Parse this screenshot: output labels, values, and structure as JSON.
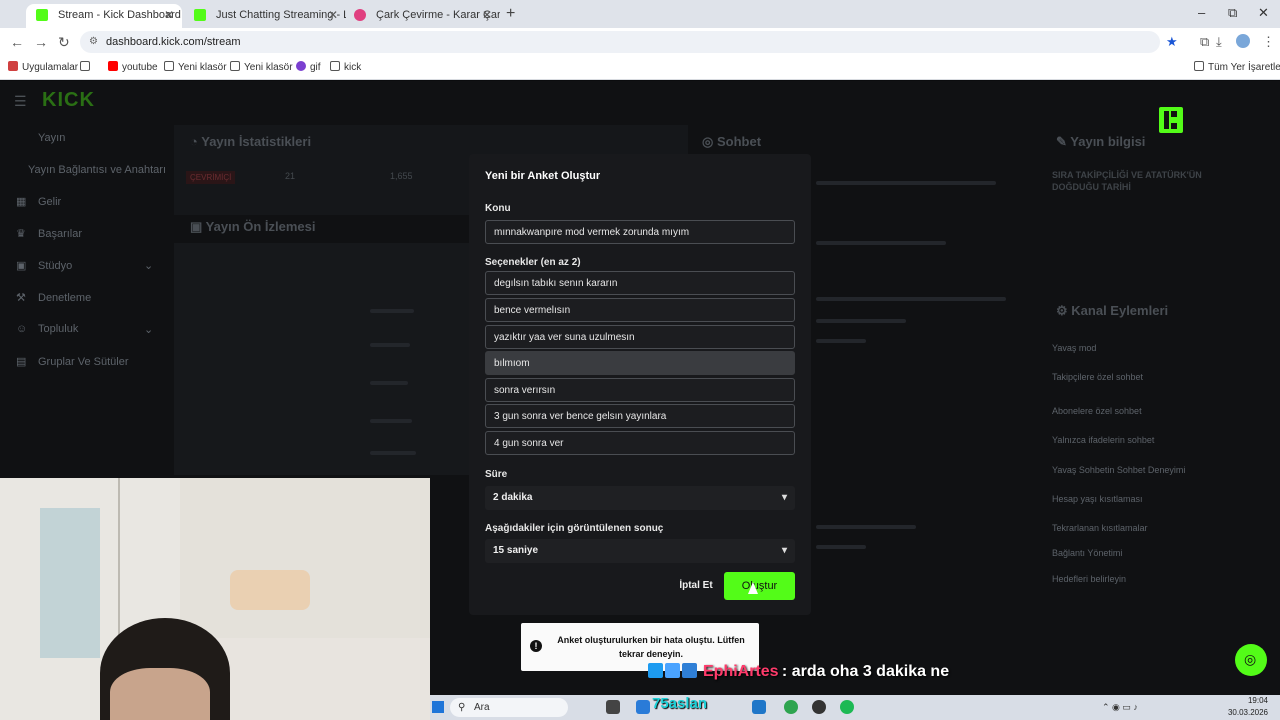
{
  "browser": {
    "tabs": [
      {
        "label": "Stream - Kick Dashboard",
        "active": true,
        "color": "#53fc18"
      },
      {
        "label": "Just Chatting Streaming - Live S",
        "active": false,
        "color": "#53fc18"
      },
      {
        "label": "Çark Çevirme - Karar Çarkı",
        "active": false,
        "color": "#e04080"
      }
    ],
    "new_tab": "+",
    "window_controls": {
      "minimize": "–",
      "restore": "⧉",
      "close": "✕"
    },
    "url": "dashboard.kick.com/stream",
    "bookmarks": [
      {
        "label": "Uygulamalar",
        "icon": "grid-icon"
      },
      {
        "label": "youtube",
        "icon": "youtube-icon"
      },
      {
        "label": "Yeni klasör",
        "icon": "folder-icon"
      },
      {
        "label": "Yeni klasör",
        "icon": "folder-icon"
      },
      {
        "label": "gif",
        "icon": "gif-icon"
      },
      {
        "label": "kick",
        "icon": "kick-icon"
      }
    ],
    "all_bookmarks": "Tüm Yer İşaretleri"
  },
  "dashboard": {
    "logo": "KICK",
    "sidebar": [
      {
        "label": "Yayın",
        "icon": "home-icon"
      },
      {
        "label": "Yayın Bağlantısı ve Anahtarı",
        "icon": ""
      },
      {
        "label": "Gelir",
        "icon": "money-icon"
      },
      {
        "label": "Başarılar",
        "icon": "trophy-icon"
      },
      {
        "label": "Stüdyo",
        "icon": "studio-icon"
      },
      {
        "label": "Denetleme",
        "icon": "shield-icon"
      },
      {
        "label": "Topluluk",
        "icon": "users-icon"
      },
      {
        "label": "Gruplar Ve Sütüler",
        "icon": "clip-icon"
      }
    ],
    "panels": {
      "stats": "Yayın İstatistikleri",
      "preview": "Yayın Ön İzlemesi",
      "chat": "Sohbet",
      "info": "Yayın bilgisi",
      "channel_actions": "Kanal Eylemleri"
    },
    "stats_values": {
      "status": "ÇEVRİMİÇİ",
      "viewers": "21",
      "followers": "1,655"
    },
    "info_title": "SIRA TAKİPÇİLİĞİ VE ATATÜRK'ÜN DOĞDUĞU TARİHİ",
    "channel_actions_items": [
      "Yavaş mod",
      "Takipçilere özel sohbet",
      "Abonelere özel sohbet",
      "Yalnızca ifadelerin sohbet",
      "Yavaş Sohbetin Sohbet Deneyimi",
      "Hesap yaşı kısıtlaması",
      "Tekrarlanan kısıtlamalar",
      "Bağlantı Yönetimi",
      "Hedefleri belirleyin"
    ]
  },
  "modal": {
    "title": "Yeni bir Anket Oluştur",
    "topic_label": "Konu",
    "topic_value": "mınnakwanpıre mod vermek zorunda mıyım",
    "options_label": "Seçenekler (en az 2)",
    "options": [
      "degılsın tabıkı senın kararın",
      "bence vermelısın",
      "yazıktır yaa ver suna uzulmesın",
      "bılmıom",
      "sonra verırsın",
      "3 gun sonra ver bence gelsın yayınlara",
      "4 gun sonra ver"
    ],
    "duration_label": "Süre",
    "duration_value": "2 dakika",
    "result_label": "Aşağıdakiler için görüntülenen sonuç",
    "result_value": "15 saniye",
    "cancel": "İptal Et",
    "create": "Oluştur"
  },
  "toast": {
    "message": "Anket oluşturulurken bir hata oluştu. Lütfen tekrar deneyin."
  },
  "stream_overlay": {
    "chat_user": "EphiArtes",
    "chat_message": ": arda oha 3 dakika ne",
    "streamer_name": "75aslan"
  },
  "taskbar": {
    "search_placeholder": "Ara",
    "time": "19:04",
    "date": "30.03.2026"
  }
}
